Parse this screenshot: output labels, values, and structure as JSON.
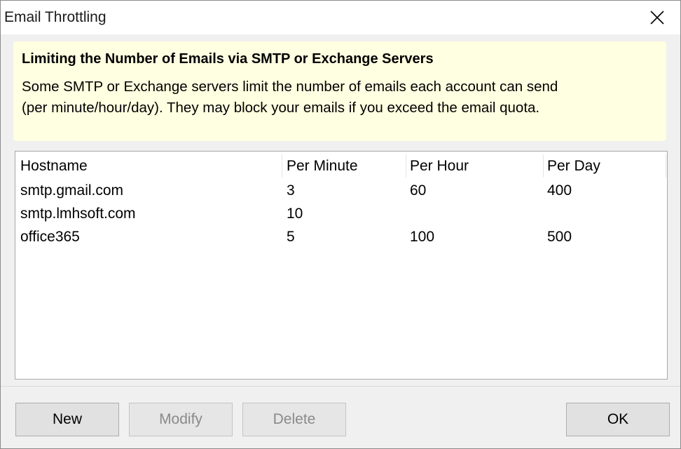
{
  "window": {
    "title": "Email Throttling"
  },
  "info": {
    "heading": "Limiting the Number of Emails via SMTP or Exchange Servers",
    "line1": "Some SMTP or Exchange servers limit the number of emails each account can send",
    "line2": "(per minute/hour/day). They may block your emails if you exceed the email quota."
  },
  "table": {
    "columns": [
      "Hostname",
      "Per Minute",
      "Per Hour",
      "Per Day"
    ],
    "rows": [
      [
        "smtp.gmail.com",
        "3",
        "60",
        "400"
      ],
      [
        "smtp.lmhsoft.com",
        "10",
        "",
        ""
      ],
      [
        "office365",
        "5",
        "100",
        "500"
      ]
    ]
  },
  "buttons": {
    "new": "New",
    "modify": "Modify",
    "delete": "Delete",
    "ok": "OK"
  },
  "icons": {
    "close": "close-icon"
  }
}
